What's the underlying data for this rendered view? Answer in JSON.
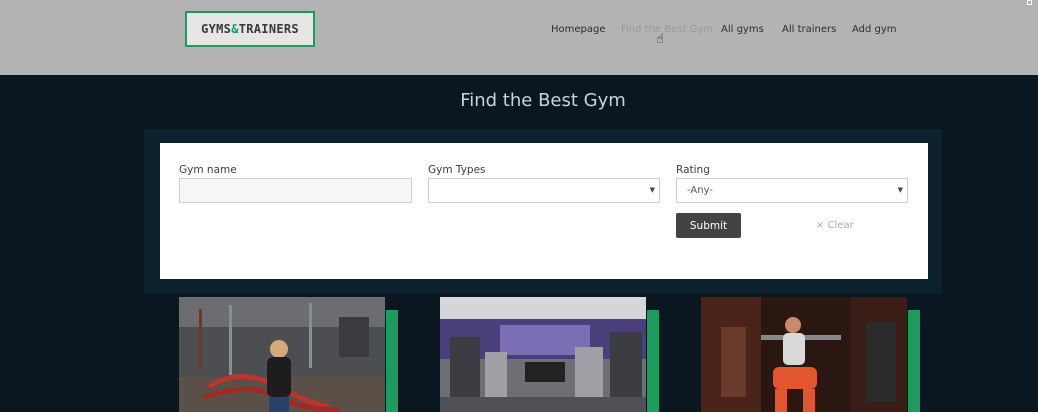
{
  "header": {
    "logo": {
      "part1": "GYMS",
      "amp": "&",
      "part2": "TRAINERS"
    },
    "nav": [
      "Homepage",
      "Find the Best Gym",
      "All gyms",
      "All trainers",
      "Add gym"
    ]
  },
  "page": {
    "title": "Find the Best Gym"
  },
  "search_form": {
    "gym_name": {
      "label": "Gym name",
      "value": "",
      "placeholder": ""
    },
    "gym_types": {
      "label": "Gym Types",
      "selected": ""
    },
    "rating": {
      "label": "Rating",
      "selected": "-Any-"
    },
    "submit_label": "Submit",
    "clear_label": "× Clear"
  },
  "gyms": [
    {
      "photo": "battle-ropes-gym-photo"
    },
    {
      "photo": "gym-machines-photo"
    },
    {
      "photo": "woman-squat-gym-photo"
    }
  ],
  "colors": {
    "accent": "#1d9b5e",
    "header_bg": "#b3b3b3",
    "page_bg": "#0a1620",
    "button_bg": "#434343"
  }
}
